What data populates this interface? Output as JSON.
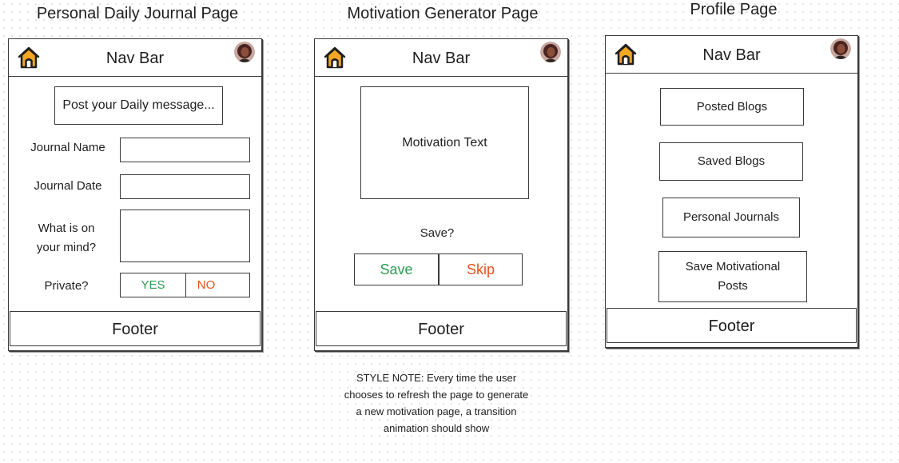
{
  "titles": {
    "journal": "Personal Daily Journal Page",
    "motivation": "Motivation Generator Page",
    "profile": "Profile Page"
  },
  "common": {
    "nav_label": "Nav Bar",
    "footer_label": "Footer",
    "home_icon": "home-icon",
    "avatar_icon": "avatar"
  },
  "journal": {
    "post_placeholder": "Post your Daily message...",
    "journal_name_label": "Journal Name",
    "journal_date_label": "Journal Date",
    "mind_label_line1": "What is on",
    "mind_label_line2": "your mind?",
    "private_label": "Private?",
    "yes_label": "YES",
    "no_label": "NO"
  },
  "motivation": {
    "text_box": "Motivation Text",
    "save_question": "Save?",
    "save_label": "Save",
    "skip_label": "Skip"
  },
  "profile": {
    "posted_blogs": "Posted Blogs",
    "saved_blogs": "Saved Blogs",
    "personal_journals": "Personal Journals",
    "save_motivational_line1": "Save Motivational",
    "save_motivational_line2": "Posts"
  },
  "style_note": {
    "line1": "STYLE NOTE: Every time the user",
    "line2": "chooses to refresh the page to generate",
    "line3": "a new motivation page, a transition",
    "line4": "animation should show"
  },
  "colors": {
    "yes": "#2a9d4e",
    "no": "#e8501f",
    "house_fill": "#f5a623",
    "outline": "#3a3a3a"
  }
}
